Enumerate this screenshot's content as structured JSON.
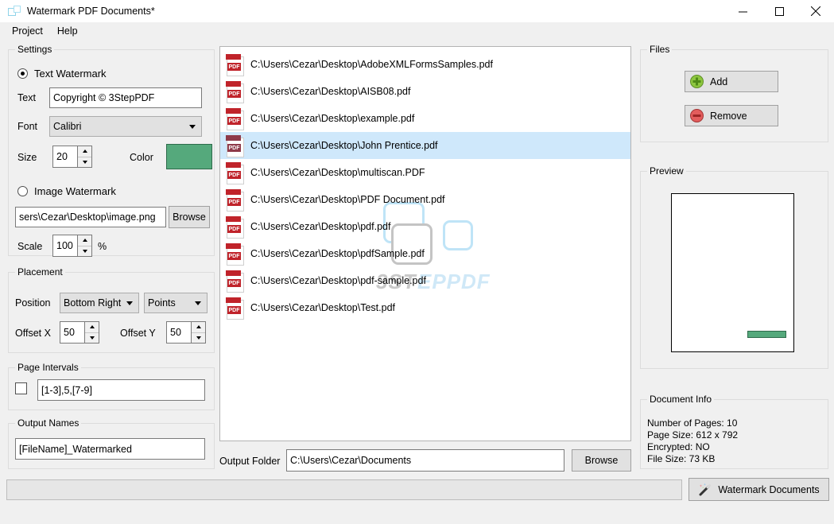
{
  "window": {
    "title": "Watermark PDF Documents*",
    "icon": "app-window-icon",
    "minimize": "minimize-icon",
    "maximize": "maximize-icon",
    "close": "close-icon"
  },
  "menu": {
    "items": [
      "Project",
      "Help"
    ]
  },
  "settings": {
    "legend": "Settings",
    "text_watermark": {
      "label": "Text Watermark",
      "selected": true
    },
    "text": {
      "label": "Text",
      "value": "Copyright © 3StepPDF"
    },
    "font": {
      "label": "Font",
      "value": "Calibri"
    },
    "size": {
      "label": "Size",
      "value": "20"
    },
    "color": {
      "label": "Color",
      "value": "#55a97c"
    },
    "image_watermark": {
      "label": "Image Watermark",
      "selected": false
    },
    "image_path": {
      "value": "sers\\Cezar\\Desktop\\image.png"
    },
    "image_browse": "Browse",
    "scale": {
      "label": "Scale",
      "value": "100",
      "unit": "%"
    }
  },
  "placement": {
    "legend": "Placement",
    "position": {
      "label": "Position",
      "value": "Bottom Right"
    },
    "units": {
      "value": "Points"
    },
    "offset_x": {
      "label": "Offset X",
      "value": "50"
    },
    "offset_y": {
      "label": "Offset Y",
      "value": "50"
    }
  },
  "page_intervals": {
    "legend": "Page Intervals",
    "enabled": false,
    "value": "[1-3],5,[7-9]"
  },
  "output_names": {
    "legend": "Output Names",
    "value": "[FileName]_Watermarked"
  },
  "file_list": {
    "selected_index": 3,
    "items": [
      "C:\\Users\\Cezar\\Desktop\\AdobeXMLFormsSamples.pdf",
      "C:\\Users\\Cezar\\Desktop\\AISB08.pdf",
      "C:\\Users\\Cezar\\Desktop\\example.pdf",
      "C:\\Users\\Cezar\\Desktop\\John Prentice.pdf",
      "C:\\Users\\Cezar\\Desktop\\multiscan.PDF",
      "C:\\Users\\Cezar\\Desktop\\PDF Document.pdf",
      "C:\\Users\\Cezar\\Desktop\\pdf.pdf",
      "C:\\Users\\Cezar\\Desktop\\pdfSample.pdf",
      "C:\\Users\\Cezar\\Desktop\\pdf-sample.pdf",
      "C:\\Users\\Cezar\\Desktop\\Test.pdf"
    ],
    "icon": "pdf-file-icon",
    "icon_badge": "PDF",
    "watermark_logo": {
      "text_dark": "3ST",
      "text_light": "EPPDF",
      "color_light": "#bfe4f7",
      "color_gray": "#bfbfbf"
    }
  },
  "output_folder": {
    "label": "Output Folder",
    "value": "C:\\Users\\Cezar\\Documents",
    "browse": "Browse"
  },
  "files_panel": {
    "legend": "Files",
    "add": {
      "label": "Add",
      "icon": "plus-circle-icon"
    },
    "remove": {
      "label": "Remove",
      "icon": "minus-circle-icon"
    }
  },
  "preview_panel": {
    "legend": "Preview"
  },
  "document_info": {
    "legend": "Document Info",
    "lines": [
      "Number of Pages: 10",
      "Page Size: 612 x 792",
      "Encrypted: NO",
      "File Size: 73 KB"
    ]
  },
  "run": {
    "label": "Watermark Documents",
    "icon": "magic-wand-icon"
  },
  "progress": {
    "value": 0
  }
}
